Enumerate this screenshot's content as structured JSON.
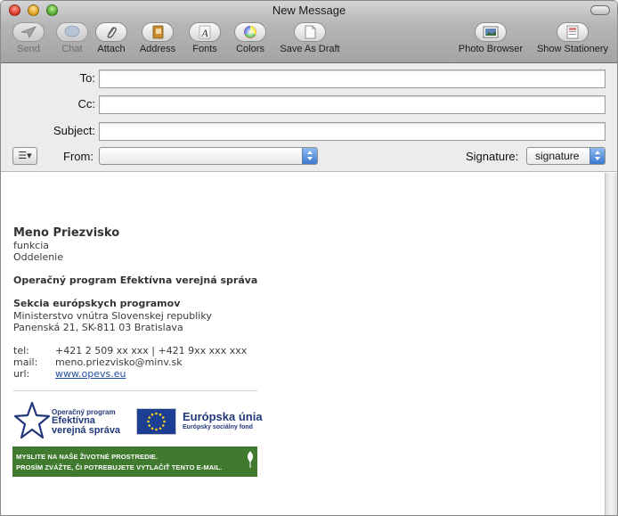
{
  "window": {
    "title": "New Message"
  },
  "toolbar": {
    "send": "Send",
    "chat": "Chat",
    "attach": "Attach",
    "address": "Address",
    "fonts": "Fonts",
    "colors": "Colors",
    "save_draft": "Save As Draft",
    "photo_browser": "Photo Browser",
    "show_stationery": "Show Stationery"
  },
  "fields": {
    "to_label": "To:",
    "cc_label": "Cc:",
    "subject_label": "Subject:",
    "from_label": "From:",
    "from_value": "",
    "signature_label": "Signature:",
    "signature_value": "signature"
  },
  "signature": {
    "name": "Meno Priezvisko",
    "function": "funkcia",
    "department": "Oddelenie",
    "program": "Operačný program Efektívna verejná správa",
    "section": "Sekcia európskych programov",
    "ministry": "Ministerstvo vnútra Slovenskej republiky",
    "address": "Panenská 21, SK-811 03 Bratislava",
    "tel_label": "tel:",
    "tel_value": "+421 2 509 xx xxx | +421 9xx xxx xxx",
    "mail_label": "mail:",
    "mail_value": "meno.priezvisko@minv.sk",
    "url_label": "url:",
    "url_value": "www.opevs.eu"
  },
  "logos": {
    "op_small": "Operačný program",
    "op_line1": "Efektívna",
    "op_line2": "verejná správa",
    "eu_title": "Európska únia",
    "eu_sub": "Európsky sociálny fond"
  },
  "banner": {
    "line1": "MYSLITE NA NAŠE ŽIVOTNÉ PROSTREDIE.",
    "line2": "PROSÍM ZVÁŽTE, ČI POTREBUJETE VYTLAČIŤ TENTO E-MAIL."
  },
  "colors": {
    "banner_green": "#3f7a2e",
    "logo_blue": "#223a7a",
    "eu_blue": "#1c3f94",
    "link_blue": "#1f4ea0"
  }
}
